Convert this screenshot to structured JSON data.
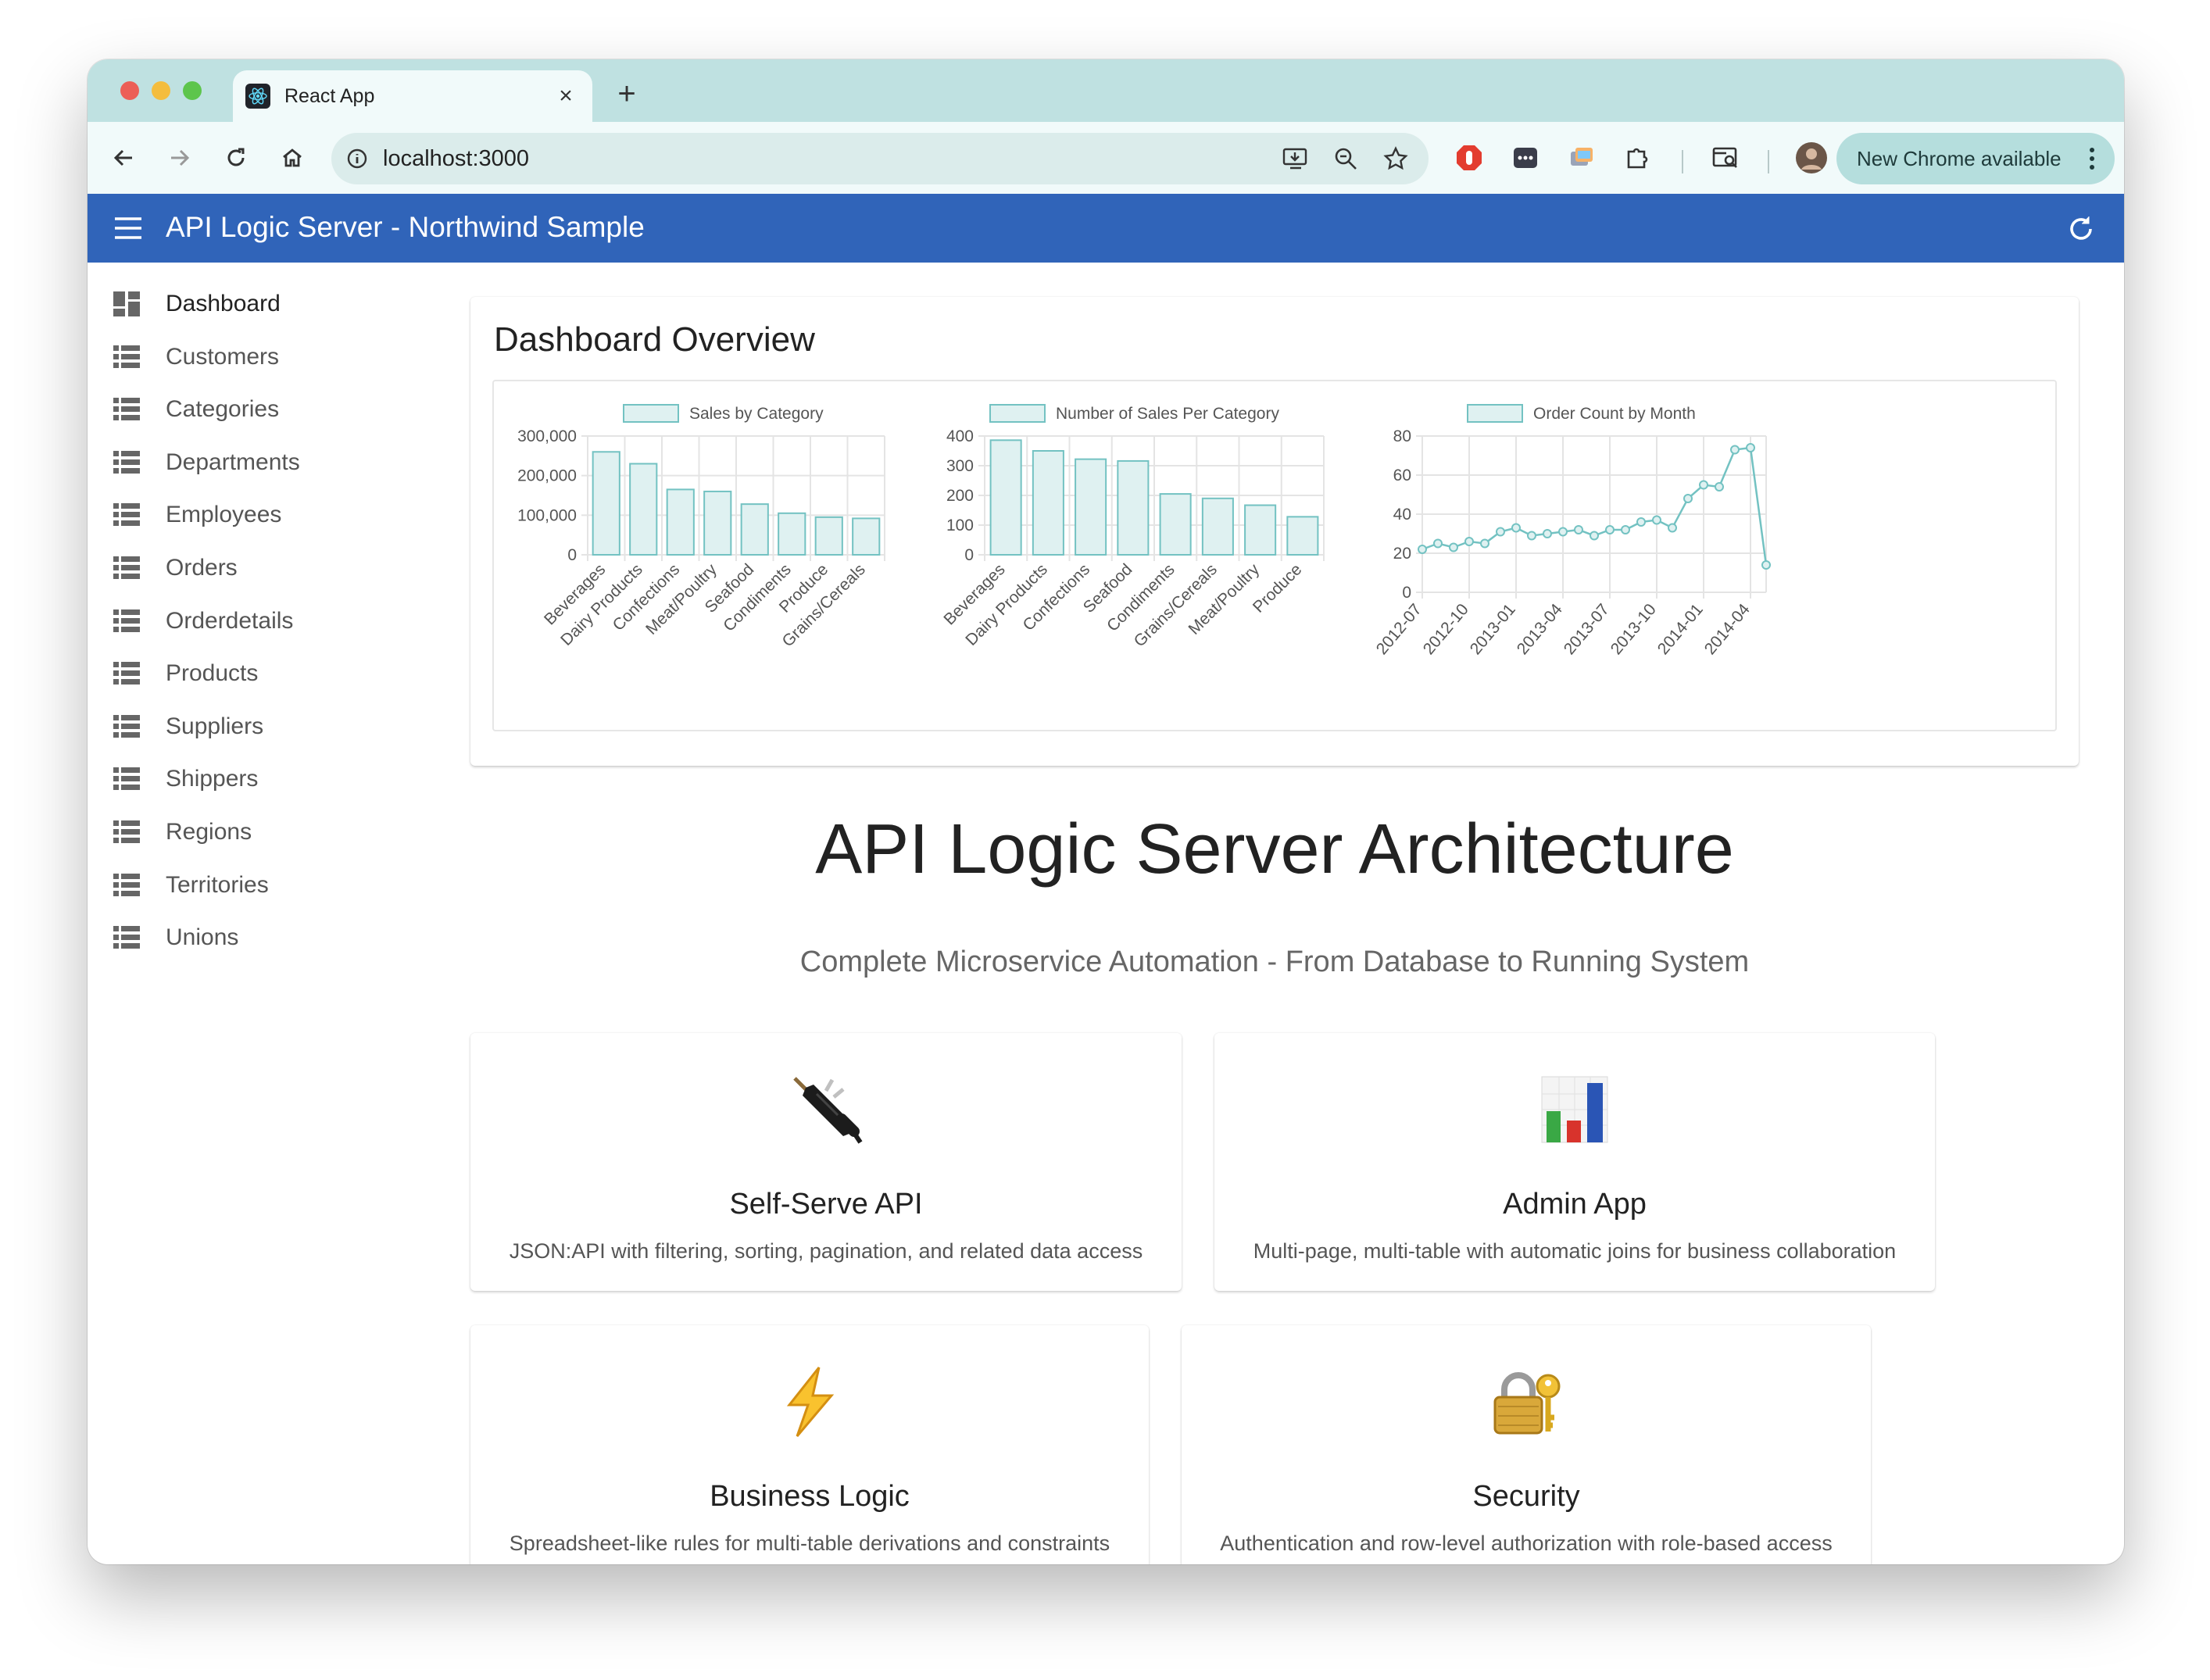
{
  "browser": {
    "tab_title": "React App",
    "tab_close": "×",
    "new_tab": "+",
    "url": "localhost:3000",
    "update_label": "New Chrome available"
  },
  "app": {
    "title": "API Logic Server - Northwind Sample"
  },
  "sidebar": {
    "items": [
      {
        "label": "Dashboard",
        "active": true
      },
      {
        "label": "Customers"
      },
      {
        "label": "Categories"
      },
      {
        "label": "Departments"
      },
      {
        "label": "Employees"
      },
      {
        "label": "Orders"
      },
      {
        "label": "Orderdetails"
      },
      {
        "label": "Products"
      },
      {
        "label": "Suppliers"
      },
      {
        "label": "Shippers"
      },
      {
        "label": "Regions"
      },
      {
        "label": "Territories"
      },
      {
        "label": "Unions"
      }
    ]
  },
  "dashboard": {
    "title": "Dashboard Overview"
  },
  "chart_data": [
    {
      "type": "bar",
      "title": "",
      "legend": "Sales by Category",
      "categories": [
        "Beverages",
        "Dairy Products",
        "Confections",
        "Meat/Poultry",
        "Seafood",
        "Condiments",
        "Produce",
        "Grains/Cereals"
      ],
      "series": [
        {
          "name": "Sales by Category",
          "values": [
            260000,
            230000,
            165000,
            160000,
            128000,
            105000,
            95000,
            92000
          ]
        }
      ],
      "ylim": [
        0,
        300000
      ],
      "yticks": [
        "0",
        "100,000",
        "200,000",
        "300,000"
      ],
      "grid": true,
      "legend_position": "top"
    },
    {
      "type": "bar",
      "title": "",
      "legend": "Number of Sales Per Category",
      "categories": [
        "Beverages",
        "Dairy Products",
        "Confections",
        "Seafood",
        "Condiments",
        "Grains/Cereals",
        "Meat/Poultry",
        "Produce"
      ],
      "series": [
        {
          "name": "Number of Sales Per Category",
          "values": [
            386,
            350,
            322,
            316,
            205,
            190,
            167,
            128
          ]
        }
      ],
      "ylim": [
        0,
        400
      ],
      "yticks": [
        "0",
        "100",
        "200",
        "300",
        "400"
      ],
      "grid": true,
      "legend_position": "top"
    },
    {
      "type": "line",
      "title": "",
      "legend": "Order Count by Month",
      "x": [
        "2012-07",
        "2012-08",
        "2012-09",
        "2012-10",
        "2012-11",
        "2012-12",
        "2013-01",
        "2013-02",
        "2013-03",
        "2013-04",
        "2013-05",
        "2013-06",
        "2013-07",
        "2013-08",
        "2013-09",
        "2013-10",
        "2013-11",
        "2013-12",
        "2014-01",
        "2014-02",
        "2014-03",
        "2014-04",
        "2014-05"
      ],
      "xticks": [
        "2012-07",
        "2012-10",
        "2013-01",
        "2013-04",
        "2013-07",
        "2013-10",
        "2014-01",
        "2014-04"
      ],
      "series": [
        {
          "name": "Order Count by Month",
          "values": [
            22,
            25,
            23,
            26,
            25,
            31,
            33,
            29,
            30,
            31,
            32,
            29,
            32,
            32,
            36,
            37,
            33,
            48,
            55,
            54,
            73,
            74,
            14
          ]
        }
      ],
      "ylim": [
        0,
        80
      ],
      "yticks": [
        "0",
        "20",
        "40",
        "60",
        "80"
      ],
      "grid": true,
      "legend_position": "top"
    }
  ],
  "architecture": {
    "title": "API Logic Server Architecture",
    "subtitle": "Complete Microservice Automation - From Database to Running System",
    "features": [
      {
        "title": "Self-Serve API",
        "desc": "JSON:API with filtering, sorting, pagination, and related data access",
        "icon": "plug-icon"
      },
      {
        "title": "Admin App",
        "desc": "Multi-page, multi-table with automatic joins for business collaboration",
        "icon": "bar-chart-icon"
      },
      {
        "title": "Business Logic",
        "desc": "Spreadsheet-like rules for multi-table derivations and constraints",
        "icon": "lightning-icon"
      },
      {
        "title": "Security",
        "desc": "Authentication and row-level authorization with role-based access",
        "icon": "lock-key-icon"
      }
    ]
  },
  "colors": {
    "appbar": "#3064b9",
    "chart_fill": "#dff1f1",
    "chart_stroke": "#73c2c2",
    "tabstrip": "#bfe1e1"
  }
}
